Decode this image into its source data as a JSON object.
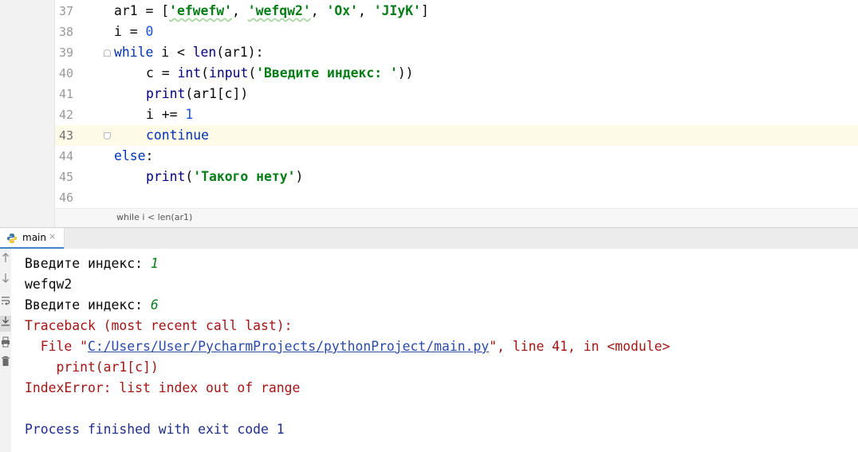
{
  "editor": {
    "lines": [
      {
        "num": "37"
      },
      {
        "num": "38"
      },
      {
        "num": "39"
      },
      {
        "num": "40"
      },
      {
        "num": "41"
      },
      {
        "num": "42"
      },
      {
        "num": "43"
      },
      {
        "num": "44"
      },
      {
        "num": "45"
      },
      {
        "num": "46"
      }
    ],
    "code": {
      "l37": {
        "a": "ar1 = [",
        "s1": "'efwefw'",
        "c1": ", ",
        "s2": "'wefqw2'",
        "c2": ", ",
        "s3": "'Ox'",
        "c3": ", ",
        "s4": "'JIyK'",
        "end": "]"
      },
      "l38": {
        "a": "i = ",
        "n": "0"
      },
      "l39": {
        "kw": "while",
        "a": " i < ",
        "fn": "len",
        "b": "(ar1):"
      },
      "l40": {
        "a": "c = ",
        "fn1": "int",
        "p1": "(",
        "fn2": "input",
        "p2": "(",
        "s": "'Введите индекс: '",
        "end": "))"
      },
      "l41": {
        "fn": "print",
        "a": "(ar1[c])"
      },
      "l42": {
        "a": "i += ",
        "n": "1"
      },
      "l43": {
        "kw": "continue"
      },
      "l44": {
        "kw": "else",
        "a": ":"
      },
      "l45": {
        "fn": "print",
        "p": "(",
        "s": "'Такого нету'",
        "end": ")"
      }
    },
    "current_line": "43",
    "breadcrumb": "while i < len(ar1)"
  },
  "run": {
    "tab_label": "main",
    "tab_close": "×",
    "console": {
      "cutoff": "'  '  '  ' '  '   '     '  '    '   '     '     '     '   '   '    '    '    '  '   '      '    '   '  '  '  '",
      "l1_prompt": "Введите индекс: ",
      "l1_value": "1",
      "l2": "wefqw2",
      "l3_prompt": "Введите индекс: ",
      "l3_value": "6",
      "l4": "Traceback (most recent call last):",
      "l5_pre": "  File \"",
      "l5_link": "C:/Users/User/PycharmProjects/pythonProject/main.py",
      "l5_post": "\", line 41, in <module>",
      "l6": "    print(ar1[c])",
      "l7": "IndexError: list index out of range",
      "l8": "Process finished with exit code 1"
    },
    "toolbar_icons": [
      "up-arrow-icon",
      "down-arrow-icon",
      "soft-wrap-icon",
      "scroll-to-end-icon",
      "print-icon",
      "trash-icon"
    ]
  },
  "colors": {
    "keyword": "#0033b3",
    "string": "#067d17",
    "number": "#1750eb",
    "error": "#a31515",
    "link": "#2a4aa8",
    "current_line_bg": "#fdfbe8"
  }
}
